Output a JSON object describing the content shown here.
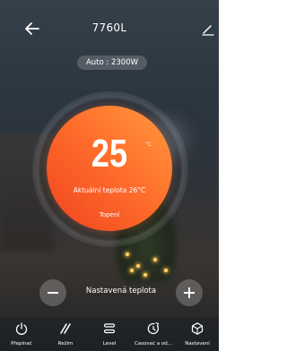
{
  "header": {
    "title": "7760L",
    "back_icon": "arrow-left-icon",
    "edit_icon": "pencil-icon"
  },
  "mode_pill": {
    "text": "Auto : 2300W"
  },
  "dial": {
    "setpoint": "25",
    "unit": "°C",
    "current_temp_text": "Aktuální teplota 26°C",
    "status": "Topení",
    "colors": {
      "gradient_start": "#ff9a3e",
      "gradient_end": "#f0431e"
    }
  },
  "setpoint_row": {
    "label": "Nastavená teplota",
    "minus_icon": "minus-icon",
    "plus_icon": "plus-icon"
  },
  "bottom_nav": {
    "items": [
      {
        "label": "Přepínač",
        "icon": "power-icon"
      },
      {
        "label": "Režim",
        "icon": "mode-slashes-icon"
      },
      {
        "label": "Level",
        "icon": "level-bars-icon"
      },
      {
        "label": "Časovač a od...",
        "icon": "timer-icon"
      },
      {
        "label": "Nastavení",
        "icon": "settings-cube-icon"
      }
    ]
  }
}
